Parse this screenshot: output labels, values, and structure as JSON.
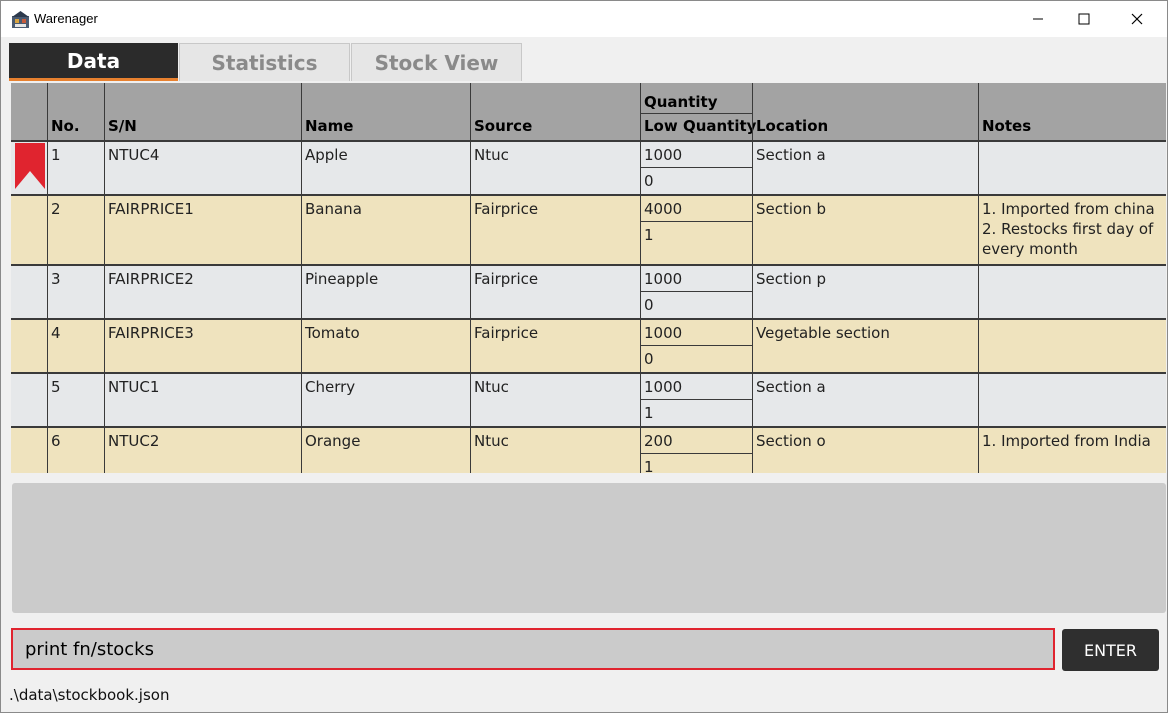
{
  "window": {
    "title": "Warenager"
  },
  "tabs": [
    {
      "label": "Data",
      "active": true
    },
    {
      "label": "Statistics",
      "active": false
    },
    {
      "label": "Stock View",
      "active": false
    }
  ],
  "table": {
    "headers": {
      "no": "No.",
      "sn": "S/N",
      "name": "Name",
      "source": "Source",
      "quantity": "Quantity",
      "low_quantity": "Low Quantity",
      "location": "Location",
      "notes": "Notes"
    },
    "rows": [
      {
        "no": "1",
        "sn": "NTUC4",
        "name": "Apple",
        "source": "Ntuc",
        "quantity": "1000",
        "low_quantity": "0",
        "location": "Section a",
        "notes": "",
        "bookmarked": true
      },
      {
        "no": "2",
        "sn": "FAIRPRICE1",
        "name": "Banana",
        "source": "Fairprice",
        "quantity": "4000",
        "low_quantity": "1",
        "location": "Section b",
        "notes": "1. Imported from china\n2. Restocks first day of every month",
        "bookmarked": false
      },
      {
        "no": "3",
        "sn": "FAIRPRICE2",
        "name": "Pineapple",
        "source": "Fairprice",
        "quantity": "1000",
        "low_quantity": "0",
        "location": "Section p",
        "notes": "",
        "bookmarked": false
      },
      {
        "no": "4",
        "sn": "FAIRPRICE3",
        "name": "Tomato",
        "source": "Fairprice",
        "quantity": "1000",
        "low_quantity": "0",
        "location": "Vegetable section",
        "notes": "",
        "bookmarked": false
      },
      {
        "no": "5",
        "sn": "NTUC1",
        "name": "Cherry",
        "source": "Ntuc",
        "quantity": "1000",
        "low_quantity": "1",
        "location": "Section a",
        "notes": "",
        "bookmarked": false
      },
      {
        "no": "6",
        "sn": "NTUC2",
        "name": "Orange",
        "source": "Ntuc",
        "quantity": "200",
        "low_quantity": "1",
        "location": "Section o",
        "notes": "1. Imported from India",
        "bookmarked": false
      }
    ]
  },
  "command": {
    "value": "print fn/stocks",
    "enter_label": "ENTER"
  },
  "status_bar": {
    "path": ".\\data\\stockbook.json"
  },
  "colors": {
    "active_tab_bg": "#2b2b2b",
    "accent_underline": "#e8812f",
    "command_border": "#e0242f",
    "bookmark": "#e0242f",
    "row_odd": "#e6e8ea",
    "row_even": "#efe3be"
  },
  "icons": {
    "app": "warehouse-icon",
    "bookmark": "bookmark-icon"
  }
}
